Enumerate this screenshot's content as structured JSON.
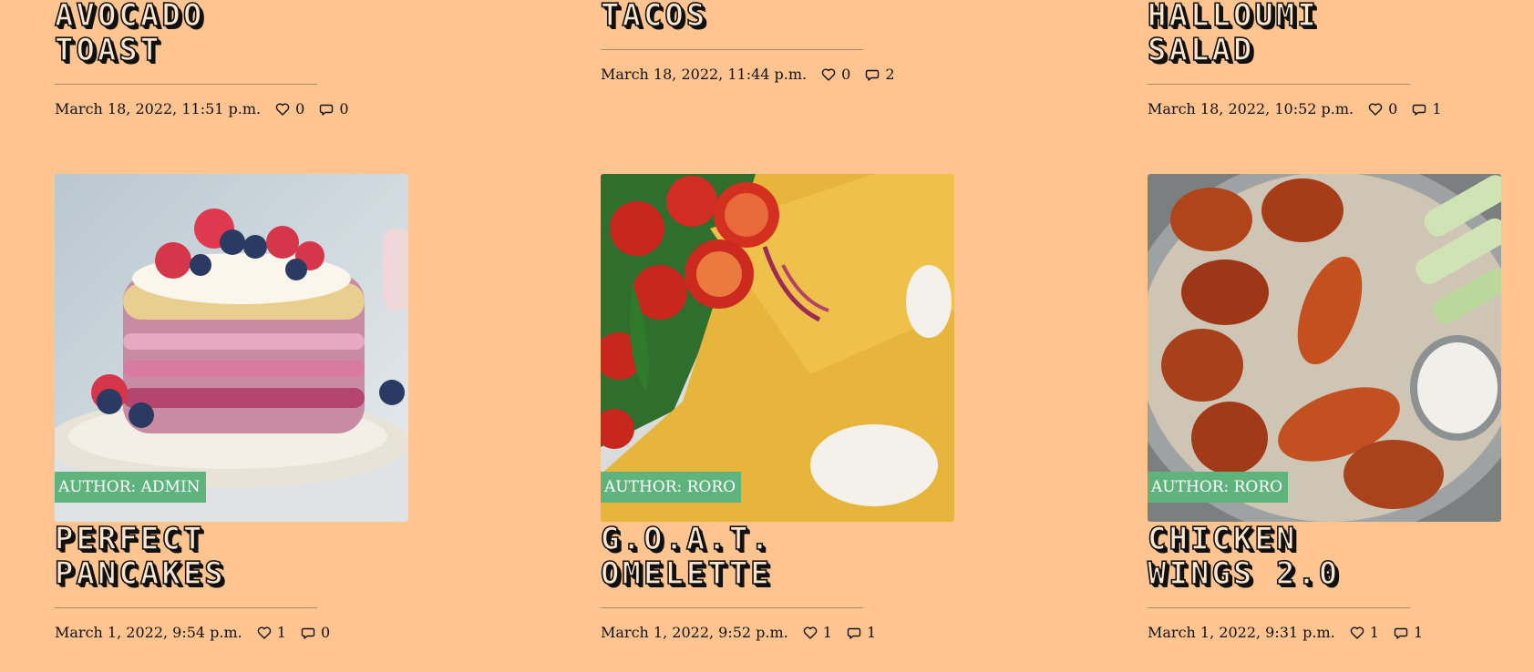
{
  "top_row": [
    {
      "title": "Avocado\nToast",
      "date": "March 18, 2022, 11:51 p.m.",
      "likes": "0",
      "comments": "0"
    },
    {
      "title": "Tacos",
      "date": "March 18, 2022, 11:44 p.m.",
      "likes": "0",
      "comments": "2"
    },
    {
      "title": "Halloumi\nSalad",
      "date": "March 18, 2022, 10:52 p.m.",
      "likes": "0",
      "comments": "1"
    }
  ],
  "bottom_row": [
    {
      "title": "Perfect\nPancakes",
      "author": "AUTHOR: ADMIN",
      "date": "March 1, 2022, 9:54 p.m.",
      "likes": "1",
      "comments": "0",
      "image": "pancakes"
    },
    {
      "title": "G.O.A.T.\nOmelette",
      "author": "AUTHOR: RORO",
      "date": "March 1, 2022, 9:52 p.m.",
      "likes": "1",
      "comments": "1",
      "image": "omelette"
    },
    {
      "title": "Chicken\nWings 2.0",
      "author": "AUTHOR: RORO",
      "date": "March 1, 2022, 9:31 p.m.",
      "likes": "1",
      "comments": "1",
      "image": "chicken-wings"
    }
  ],
  "icons": {
    "like": "heart-icon",
    "comment": "comment-icon"
  },
  "colors": {
    "background": "#ffc48f",
    "badge": "#5fb37d"
  }
}
